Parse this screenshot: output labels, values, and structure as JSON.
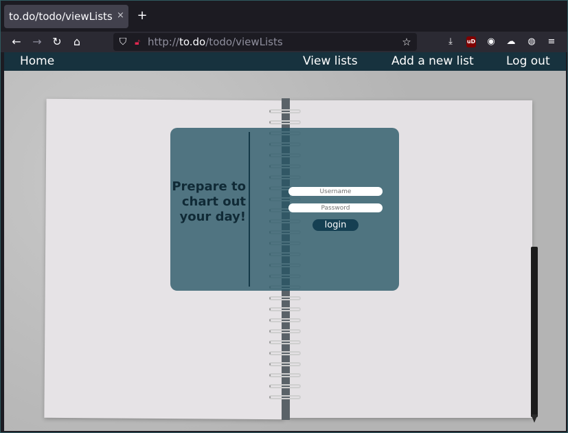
{
  "browser": {
    "tab_title": "to.do/todo/viewLists",
    "tab_close": "×",
    "new_tab": "+",
    "url_prefix": "http://",
    "url_host": "to.do",
    "url_path": "/todo/viewLists",
    "ublock_badge": "uD"
  },
  "nav": {
    "home": "Home",
    "view_lists": "View lists",
    "add_list": "Add a new list",
    "logout": "Log out"
  },
  "login": {
    "tagline": "Prepare to chart out your day!",
    "username_placeholder": "Username",
    "password_placeholder": "Password",
    "button": "login"
  },
  "colors": {
    "header_bg": "#17323e",
    "card_bg": "#255464",
    "button_bg": "#153f52",
    "tab_bg": "#42414d"
  }
}
